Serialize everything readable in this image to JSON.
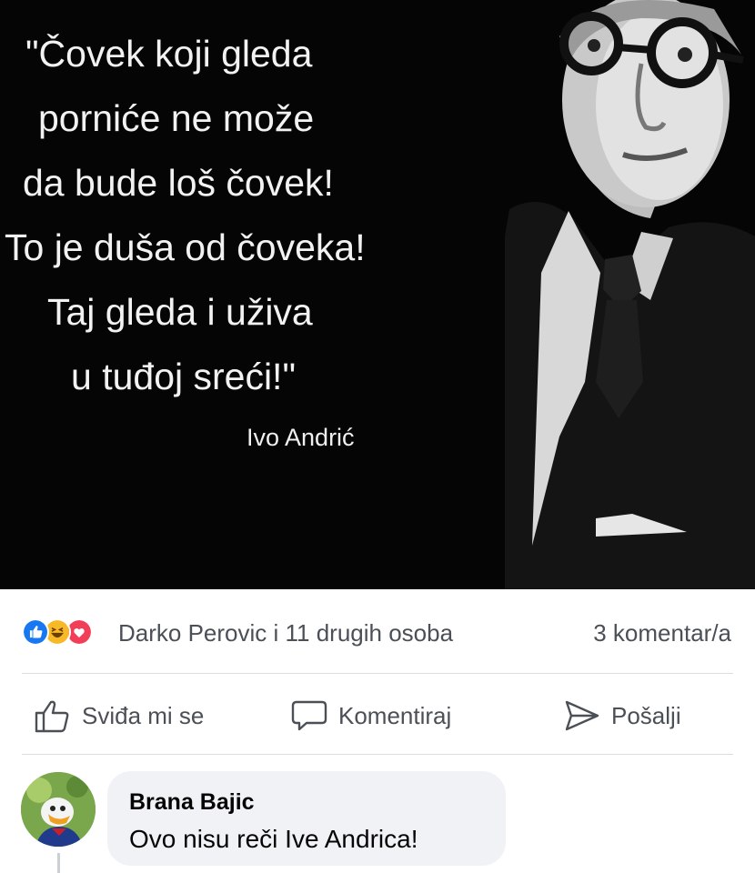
{
  "post": {
    "quote_lines": [
      "\"Čovek koji gleda",
      "porniće ne može",
      "da bude loš čovek!",
      "To je duša od čoveka!",
      "Taj gleda i uživa",
      "u tuđoj sreći!\""
    ],
    "author": "Ivo Andrić"
  },
  "reactions": {
    "icons": [
      "like-icon",
      "haha-icon",
      "love-icon"
    ],
    "colors": {
      "like": "#1877f2",
      "haha": "#f7b928",
      "love": "#f33e58"
    },
    "summary": "Darko Perovic i 11 drugih osoba",
    "comment_count": "3 komentar/a"
  },
  "actions": {
    "like_label": "Sviđa mi se",
    "comment_label": "Komentiraj",
    "share_label": "Pošalji"
  },
  "comment": {
    "author": "Brana Bajic",
    "text": "Ovo nisu reči Ive Andrica!"
  }
}
